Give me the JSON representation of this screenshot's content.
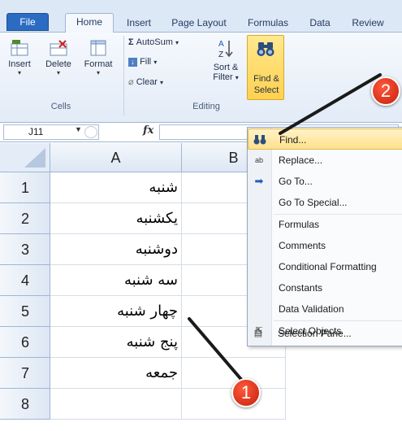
{
  "ribbon_tabs": [
    "File",
    "Home",
    "Insert",
    "Page Layout",
    "Formulas",
    "Data",
    "Review"
  ],
  "cells_group": {
    "label": "Cells",
    "buttons": [
      {
        "label": "Insert",
        "icon": "insert-cells-icon"
      },
      {
        "label": "Delete",
        "icon": "delete-cells-icon"
      },
      {
        "label": "Format",
        "icon": "format-cells-icon"
      }
    ]
  },
  "editing_group": {
    "label": "Editing",
    "autosum": "AutoSum",
    "fill": "Fill",
    "clear": "Clear",
    "sort_filter_1": "Sort &",
    "sort_filter_2": "Filter",
    "find_select_1": "Find &",
    "find_select_2": "Select"
  },
  "formula_bar": {
    "name_box": "J11",
    "fx": "fx"
  },
  "grid": {
    "columns": [
      "A",
      "B"
    ],
    "rows": [
      {
        "n": "1",
        "a": "شنبه"
      },
      {
        "n": "2",
        "a": "يكشنبه"
      },
      {
        "n": "3",
        "a": "دوشنبه"
      },
      {
        "n": "4",
        "a": "سه شنبه"
      },
      {
        "n": "5",
        "a": "چهار شنبه"
      },
      {
        "n": "6",
        "a": "پنج شنبه"
      },
      {
        "n": "7",
        "a": "جمعه"
      },
      {
        "n": "8",
        "a": ""
      }
    ]
  },
  "menu": {
    "items": [
      {
        "label": "Find...",
        "icon": "binoculars-icon",
        "highlighted": true
      },
      {
        "label": "Replace...",
        "icon": "replace-icon"
      },
      {
        "label": "Go To...",
        "icon": "goto-arrow-icon"
      },
      {
        "label": "Go To Special..."
      },
      {
        "label": "Formulas"
      },
      {
        "label": "Comments"
      },
      {
        "label": "Conditional Formatting"
      },
      {
        "label": "Constants"
      },
      {
        "label": "Data Validation"
      },
      {
        "label": "Select Objects",
        "icon": "pointer-icon"
      },
      {
        "label": "Selection Pane...",
        "icon": "selection-pane-icon"
      }
    ]
  },
  "callouts": [
    "1",
    "2"
  ],
  "colors": {
    "ribbon_bg": "#dde8f6",
    "file_tab": "#2b6cc2",
    "highlight": "#ffe08c",
    "callout_red": "#d62b12"
  }
}
